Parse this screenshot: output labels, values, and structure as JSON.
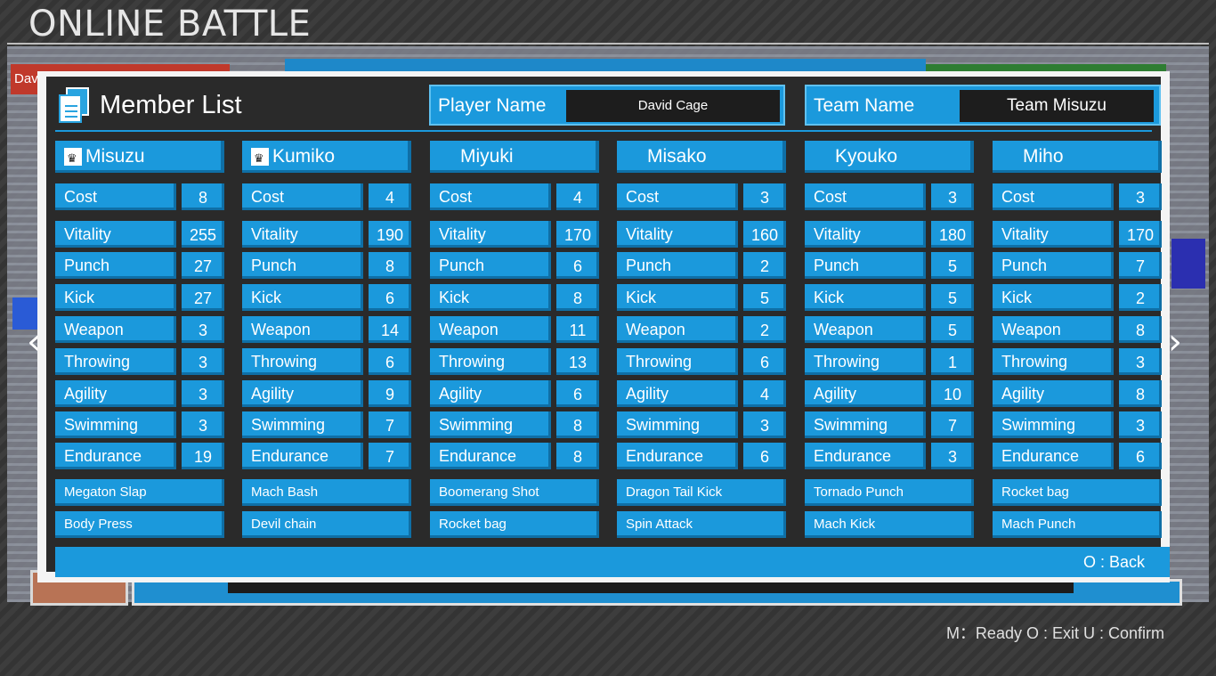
{
  "screen_title": "ONLINE BATTLE",
  "background": {
    "red_label": "Davi"
  },
  "panel": {
    "title": "Member List",
    "player_name_label": "Player Name",
    "player_name": "David Cage",
    "team_name_label": "Team Name",
    "team_name": "Team Misuzu",
    "back_hint": "O : Back"
  },
  "stat_labels": {
    "cost": "Cost",
    "vitality": "Vitality",
    "punch": "Punch",
    "kick": "Kick",
    "weapon": "Weapon",
    "throwing": "Throwing",
    "agility": "Agility",
    "swimming": "Swimming",
    "endurance": "Endurance"
  },
  "members": [
    {
      "name": "Misuzu",
      "crown": true,
      "cost": "8",
      "vitality": "255",
      "punch": "27",
      "kick": "27",
      "weapon": "3",
      "throwing": "3",
      "agility": "3",
      "swimming": "3",
      "endurance": "19",
      "skill1": "Megaton Slap",
      "skill2": "Body Press"
    },
    {
      "name": "Kumiko",
      "crown": true,
      "cost": "4",
      "vitality": "190",
      "punch": "8",
      "kick": "6",
      "weapon": "14",
      "throwing": "6",
      "agility": "9",
      "swimming": "7",
      "endurance": "7",
      "skill1": "Mach Bash",
      "skill2": "Devil chain"
    },
    {
      "name": "Miyuki",
      "crown": false,
      "cost": "4",
      "vitality": "170",
      "punch": "6",
      "kick": "8",
      "weapon": "11",
      "throwing": "13",
      "agility": "6",
      "swimming": "8",
      "endurance": "8",
      "skill1": "Boomerang Shot",
      "skill2": "Rocket bag"
    },
    {
      "name": "Misako",
      "crown": false,
      "cost": "3",
      "vitality": "160",
      "punch": "2",
      "kick": "5",
      "weapon": "2",
      "throwing": "6",
      "agility": "4",
      "swimming": "3",
      "endurance": "6",
      "skill1": "Dragon Tail Kick",
      "skill2": "Spin Attack"
    },
    {
      "name": "Kyouko",
      "crown": false,
      "cost": "3",
      "vitality": "180",
      "punch": "5",
      "kick": "5",
      "weapon": "5",
      "throwing": "1",
      "agility": "10",
      "swimming": "7",
      "endurance": "3",
      "skill1": "Tornado Punch",
      "skill2": "Mach Kick"
    },
    {
      "name": "Miho",
      "crown": false,
      "cost": "3",
      "vitality": "170",
      "punch": "7",
      "kick": "2",
      "weapon": "8",
      "throwing": "3",
      "agility": "8",
      "swimming": "3",
      "endurance": "6",
      "skill1": "Rocket bag",
      "skill2": "Mach Punch"
    }
  ],
  "controls_hint": "M：Ready  O : Exit  U : Confirm",
  "icons": {
    "prev": "chevron-left-icon",
    "next": "chevron-right-icon",
    "crown": "crown-icon",
    "title": "document-icon"
  }
}
